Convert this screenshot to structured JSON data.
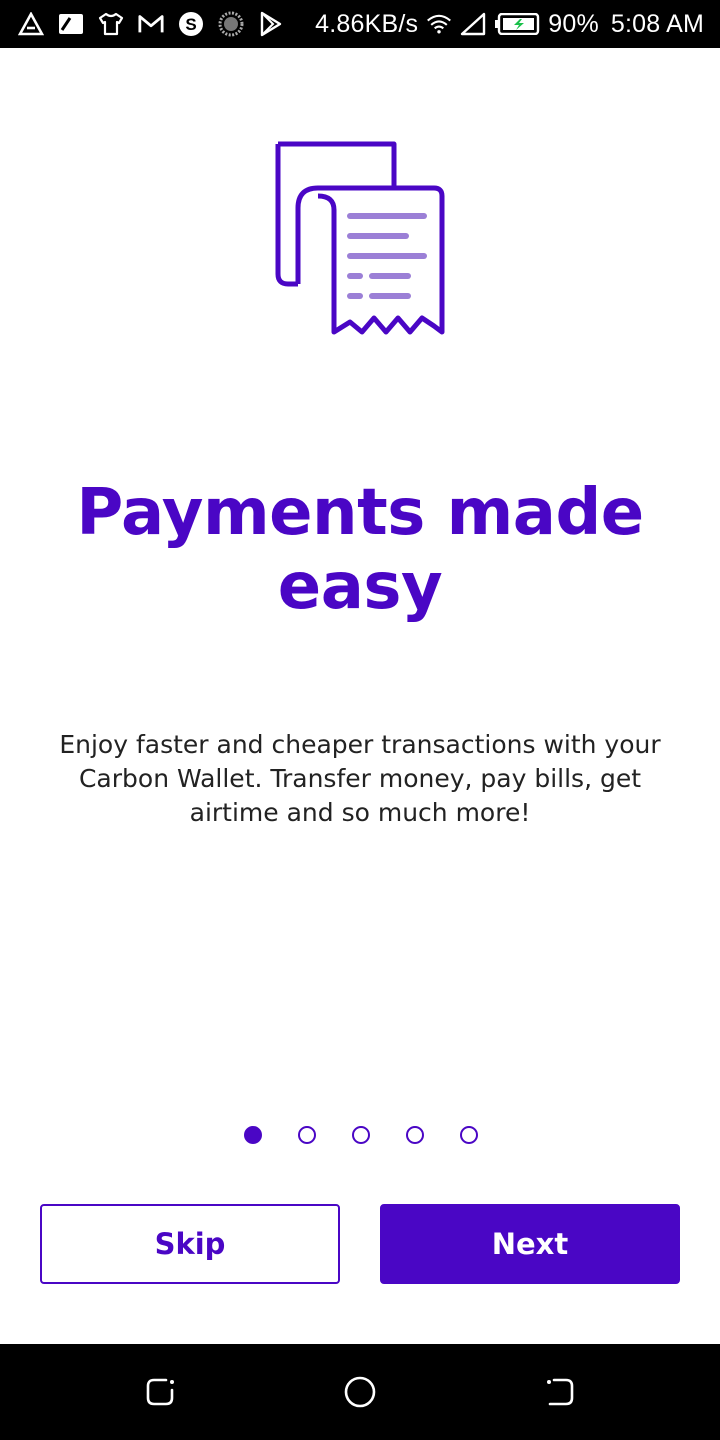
{
  "status_bar": {
    "speed": "4.86KB/s",
    "battery_percent": "90%",
    "time": "5:08 AM",
    "left_icons": [
      "alert-triangle-icon",
      "news-icon",
      "tshirt-icon",
      "gmail-icon",
      "skype-icon",
      "dotted-circle-icon",
      "play-store-icon"
    ],
    "right_icons": [
      "wifi-icon",
      "signal-icon",
      "battery-charging-icon"
    ]
  },
  "illustration": {
    "icon": "receipt-documents-icon"
  },
  "onboarding": {
    "title": "Payments made easy",
    "description": "Enjoy faster and cheaper transactions with your Carbon Wallet. Transfer money, pay bills, get airtime and so much more!",
    "pages_total": 5,
    "active_page": 1
  },
  "buttons": {
    "skip_label": "Skip",
    "next_label": "Next"
  },
  "nav_bar": {
    "icons": [
      "recent-apps-icon",
      "home-icon",
      "back-icon"
    ]
  },
  "colors": {
    "accent": "#4a06c5",
    "accent_light": "#9b7fd6",
    "text": "#222222",
    "background": "#ffffff",
    "system_bars": "#000000"
  }
}
